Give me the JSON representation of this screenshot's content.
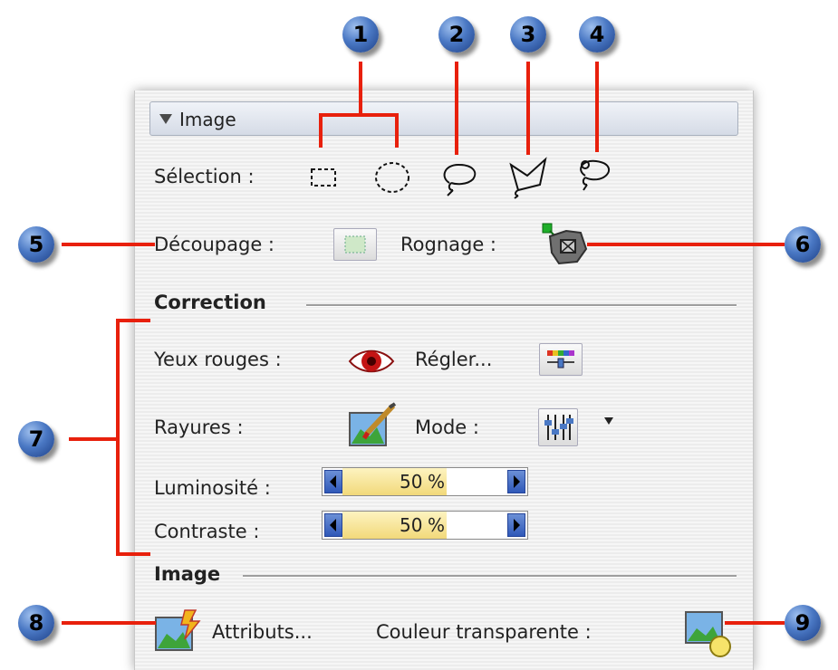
{
  "panel": {
    "header_title": "Image",
    "selection_label": "Sélection :",
    "decoupage_label": "Découpage :",
    "rognage_label": "Rognage :",
    "correction_section": "Correction",
    "yeux_rouges_label": "Yeux rouges :",
    "regler_label": "Régler...",
    "rayures_label": "Rayures :",
    "mode_label": "Mode :",
    "luminosite_label": "Luminosité :",
    "luminosite": {
      "value": "50",
      "unit": "%"
    },
    "contraste_label": "Contraste :",
    "contraste": {
      "value": "50",
      "unit": "%"
    },
    "image_section": "Image",
    "attributs_label": "Attributs...",
    "couleur_label": "Couleur transparente :"
  },
  "callouts": [
    "1",
    "2",
    "3",
    "4",
    "5",
    "6",
    "7",
    "8",
    "9"
  ],
  "colors": {
    "callout_line": "#e8200c",
    "callout_badge": "#3c68b8",
    "slider_fill": "#f2d97a"
  }
}
